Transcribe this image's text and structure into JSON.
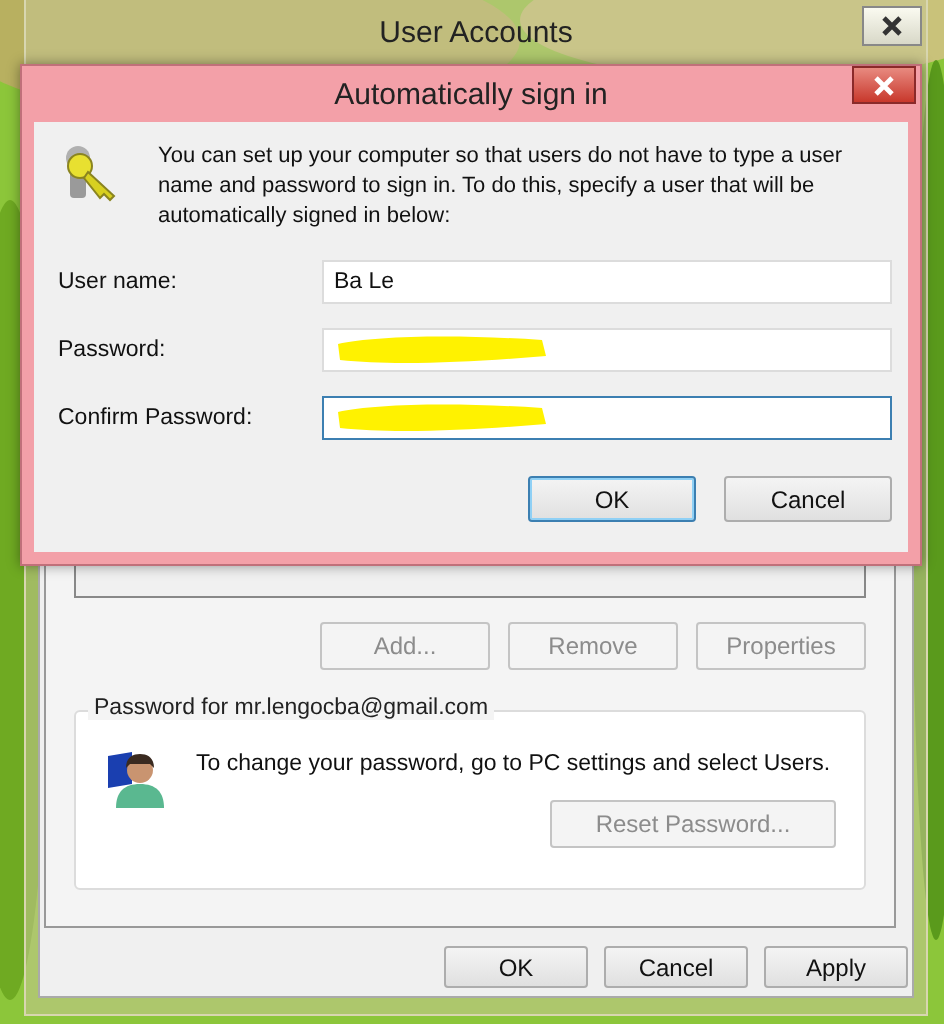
{
  "window": {
    "title": "User Accounts"
  },
  "list_buttons": [
    {
      "label": "Add...",
      "disabled": true
    },
    {
      "label": "Remove",
      "disabled": true
    },
    {
      "label": "Properties",
      "disabled": true
    }
  ],
  "password_group": {
    "legend": "Password for mr.lengocba@gmail.com",
    "message": "To change your password, go to PC settings and select Users.",
    "button": {
      "label": "Reset Password...",
      "disabled": true
    }
  },
  "buttons": [
    {
      "label": "OK",
      "default": false
    },
    {
      "label": "Cancel",
      "default": false
    },
    {
      "label": "Apply",
      "default": false
    }
  ],
  "dialog": {
    "title": "Automatically sign in",
    "message": "You can set up your computer so that users do not have to type a user name and password to sign in. To do this, specify a user that will be automatically signed in below:",
    "fields": [
      {
        "label": "User name:",
        "value": "Ba Le",
        "redacted": false,
        "focused": false
      },
      {
        "label": "Password:",
        "redacted": true,
        "focused": false
      },
      {
        "label": "Confirm Password:",
        "redacted": true,
        "focused": true
      }
    ],
    "buttons": [
      {
        "label": "OK",
        "default": true
      },
      {
        "label": "Cancel",
        "default": false
      }
    ]
  }
}
